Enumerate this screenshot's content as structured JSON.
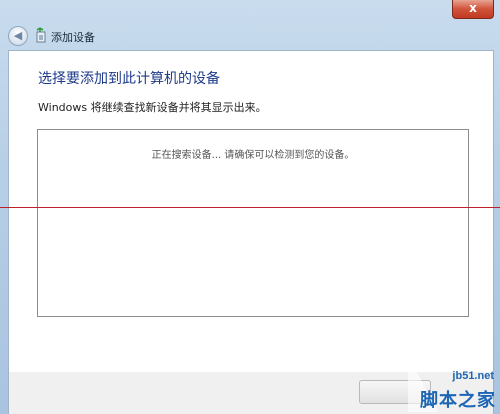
{
  "window": {
    "title": "添加设备",
    "close_label": "x"
  },
  "nav": {
    "back_glyph": "◀"
  },
  "main": {
    "heading": "选择要添加到此计算机的设备",
    "subtext": "Windows 将继续查找新设备并将其显示出来。",
    "device_list": {
      "status_text": "正在搜索设备... 请确保可以检测到您的设备。"
    }
  },
  "watermark": {
    "site": "jb51.net",
    "brand": "脚本之家"
  },
  "colors": {
    "heading": "#1e3b8a",
    "close_button": "#c23a22",
    "divider": "#c0202e",
    "watermark": "#1e66b4"
  }
}
